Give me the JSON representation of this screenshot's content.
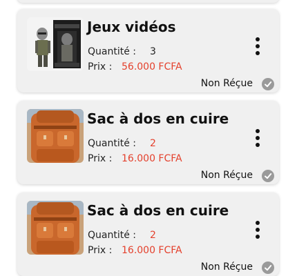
{
  "orders": [
    {
      "title": "Jeux vidéos",
      "quantity_label": "Quantité :",
      "quantity": "3",
      "price_label": "Prix :",
      "price": "56.000 FCFA",
      "status": "Non Réçue",
      "image": "action-figure-box"
    },
    {
      "title": "Sac à dos en cuire",
      "quantity_label": "Quantité :",
      "quantity": "2",
      "price_label": "Prix :",
      "price": "16.000 FCFA",
      "status": "Non Réçue",
      "image": "leather-backpack"
    },
    {
      "title": "Sac à dos en cuire",
      "quantity_label": "Quantité :",
      "quantity": "2",
      "price_label": "Prix :",
      "price": "16.000 FCFA",
      "status": "Non Réçue",
      "image": "leather-backpack"
    }
  ],
  "icons": {
    "menu": "more-vertical-icon",
    "status": "check-circle-icon"
  },
  "colors": {
    "price": "#e4402c",
    "card_bg": "#f0f0f0",
    "status_icon": "#9a9a9a"
  }
}
